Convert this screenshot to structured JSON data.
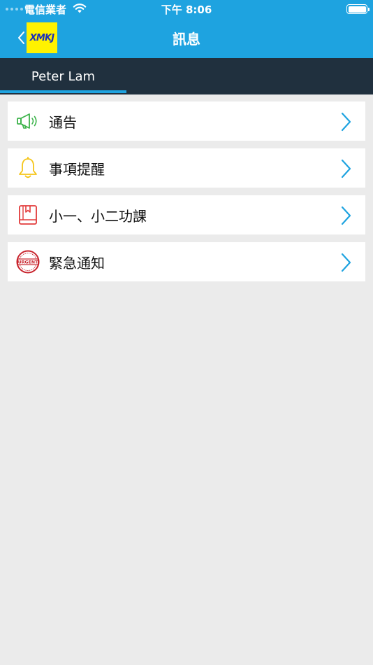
{
  "status_bar": {
    "carrier": "電信業者",
    "time": "下午 8:06"
  },
  "nav": {
    "back_icon": "chevron-left-icon",
    "logo_text": "XMKJ",
    "logo_bg": "#fff200",
    "title": "訊息"
  },
  "tabs": [
    {
      "label": "Peter Lam",
      "selected": true
    }
  ],
  "menu": [
    {
      "label": "通告",
      "icon": "megaphone-icon",
      "icon_color": "#3cb34a"
    },
    {
      "label": "事項提醒",
      "icon": "bell-icon",
      "icon_color": "#f5c518"
    },
    {
      "label": "小一、小二功課",
      "icon": "book-icon",
      "icon_color": "#e23b3b"
    },
    {
      "label": "緊急通知",
      "icon": "urgent-stamp-icon",
      "icon_color": "#c8232c",
      "stamp_text": "URGENT"
    }
  ],
  "colors": {
    "accent": "#1ea3e0",
    "tab_bar": "#20303e",
    "background": "#ebebeb"
  }
}
